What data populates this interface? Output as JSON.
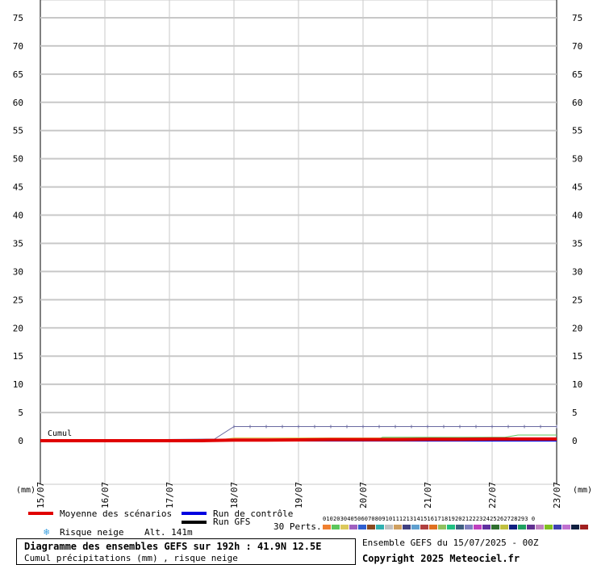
{
  "chart_data": {
    "type": "line",
    "y_unit_label": "(mm)",
    "ylim": [
      0,
      75
    ],
    "y_ticks": [
      0,
      5,
      10,
      15,
      20,
      25,
      30,
      35,
      40,
      45,
      50,
      55,
      60,
      65,
      70,
      75
    ],
    "x_ticks": [
      "15/07",
      "16/07",
      "17/07",
      "18/07",
      "19/07",
      "20/07",
      "21/07",
      "22/07",
      "23/07"
    ],
    "grid": true,
    "annotation": "Cumul",
    "series": [
      {
        "name": "Moyenne des scénarios",
        "color": "#e00000",
        "x": [
          0,
          0.5,
          1,
          1.5,
          2,
          2.5,
          3,
          3.5,
          4,
          4.5,
          5,
          5.5,
          6,
          6.5,
          7,
          7.5,
          8
        ],
        "values": [
          0,
          0,
          0,
          0,
          0,
          0,
          0.1,
          0.1,
          0.15,
          0.2,
          0.2,
          0.2,
          0.25,
          0.25,
          0.3,
          0.3,
          0.3
        ]
      },
      {
        "name": "Run de contrôle",
        "color": "#0000e0",
        "x": [
          0,
          2,
          3,
          8
        ],
        "values": [
          0,
          0,
          0,
          0
        ]
      },
      {
        "name": "Run GFS",
        "color": "#000000",
        "x": [
          0,
          2,
          3,
          8
        ],
        "values": [
          0,
          0,
          0,
          0
        ]
      },
      {
        "color": "#6a6aa0",
        "x": [
          0,
          2.7,
          3,
          8
        ],
        "values": [
          0,
          0.3,
          2.5,
          2.5
        ]
      },
      {
        "color": "#5cc65c",
        "x": [
          0,
          5.2,
          5.3,
          7.2,
          7.4,
          8
        ],
        "values": [
          0,
          0,
          0.6,
          0.6,
          1.0,
          1.0
        ]
      },
      {
        "color": "#dcc95c",
        "x": [
          0,
          2.7,
          3,
          8
        ],
        "values": [
          0,
          0,
          0.5,
          0.5
        ]
      },
      {
        "color": "#f08030",
        "x": [
          0,
          2.7,
          3,
          8
        ],
        "values": [
          0,
          0,
          0.3,
          0.3
        ]
      },
      {
        "color": "#3060d0",
        "x": [
          0,
          2.7,
          3,
          8
        ],
        "values": [
          0,
          0.2,
          0.2,
          0.2
        ]
      }
    ],
    "ensemble_colors": [
      "#f08030",
      "#5cc65c",
      "#dcc95c",
      "#a060c0",
      "#3060d0",
      "#8a4a20",
      "#30b0b0",
      "#c0c0c0",
      "#d0a060",
      "#404080",
      "#60a0d0",
      "#b04040",
      "#e07020",
      "#90c060",
      "#20c080",
      "#406080",
      "#8080c0",
      "#c040c0",
      "#6030a0",
      "#307030",
      "#c0c040",
      "#102080",
      "#20a060",
      "#603090",
      "#c080c0",
      "#80c020",
      "#4040b0",
      "#c070d0",
      "#102040",
      "#a02020"
    ]
  },
  "legend": {
    "mean": "Moyenne des scénarios",
    "control": "Run de contrôle",
    "gfs": "Run GFS",
    "snow": "Risque neige",
    "alt": "Alt. 141m",
    "perts": "30 Perts.",
    "perts_numbers": "01020304050607080910111213141516171819202122232425262728293 0"
  },
  "info": {
    "title": "Diagramme des ensembles GEFS sur 192h : 41.9N 12.5E",
    "subtitle": "Cumul précipitations (mm) , risque neige",
    "run": "Ensemble GEFS du 15/07/2025 - 00Z",
    "copyright": "Copyright 2025 Meteociel.fr"
  }
}
